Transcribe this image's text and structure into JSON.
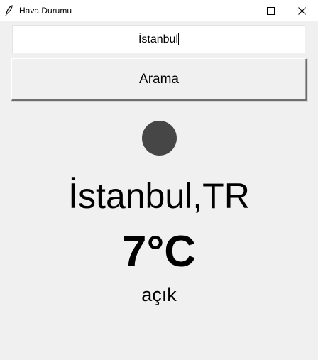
{
  "window": {
    "title": "Hava Durumu",
    "app_icon": "feather-icon",
    "controls": [
      "minimize-icon",
      "maximize-icon",
      "close-icon"
    ]
  },
  "search": {
    "value": "İstanbul"
  },
  "search_button": {
    "label": "Arama"
  },
  "weather": {
    "icon": "weather-condition-icon",
    "icon_color": "#464646",
    "location": "İstanbul,TR",
    "temperature": "7°C",
    "condition": "açık"
  },
  "colors": {
    "background": "#f0f0f0",
    "titlebar": "#ffffff",
    "text": "#000000"
  }
}
